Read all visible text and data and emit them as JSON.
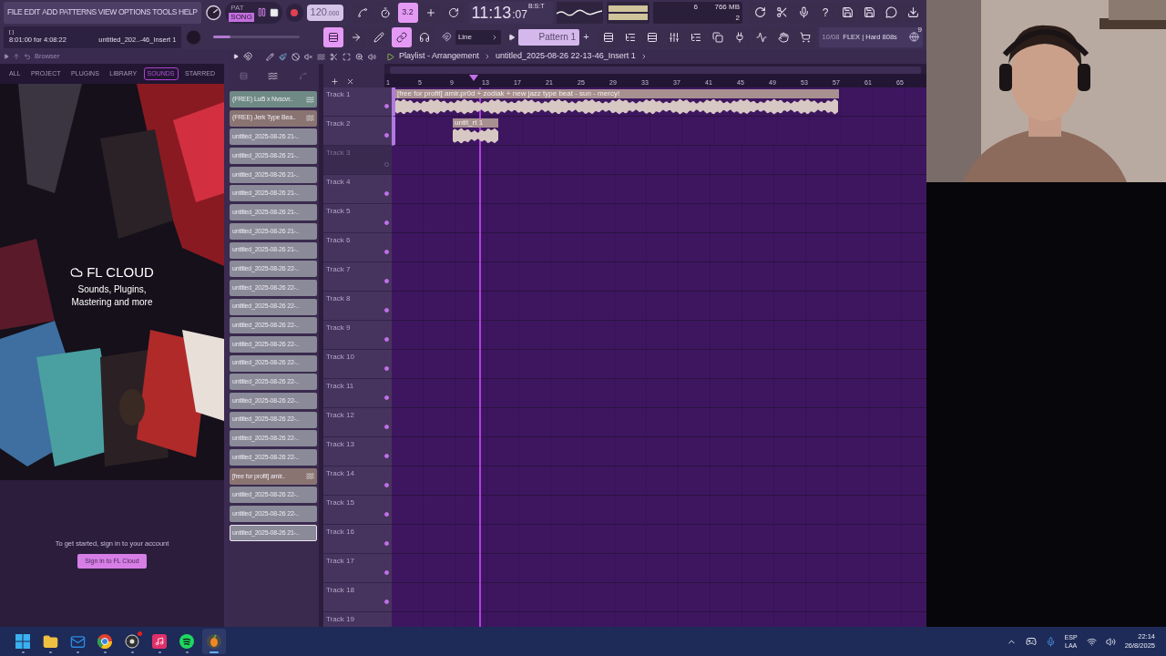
{
  "menu": [
    "FILE",
    "EDIT",
    "ADD",
    "PATTERNS",
    "VIEW",
    "OPTIONS",
    "TOOLS",
    "HELP"
  ],
  "transport": {
    "modes": [
      {
        "label": "PAT",
        "selected": false
      },
      {
        "label": "SONG",
        "selected": true
      }
    ],
    "tempo": "120",
    "tempo_fraction": ".000"
  },
  "tool_buttons": [
    {
      "on": false
    },
    {
      "on": false
    },
    {
      "label": "3.2",
      "on": true
    },
    {
      "on": false
    },
    {
      "on": false
    }
  ],
  "clock": {
    "main": "11:13",
    "seconds": ":07",
    "unit": "B:S:T"
  },
  "resources": {
    "voices": "6",
    "memory": "766 MB",
    "cores": "2"
  },
  "help_label": "?",
  "hint": {
    "bracket": "[ ]",
    "time": "8:01:00 for 4:08:22",
    "target": "untitled_202..-46_Insert 1"
  },
  "master_pitch": {
    "level": 0.2
  },
  "mode_buttons": [
    {
      "on": true
    },
    {
      "on": false
    },
    {
      "on": false
    },
    {
      "on": true
    },
    {
      "on": false
    }
  ],
  "snap": "Line",
  "pattern": "Pattern 1",
  "pattern_add": "+",
  "news": {
    "date": "10/08",
    "title": "FLEX | Hard 808s",
    "count": "9"
  },
  "browser": {
    "title": "Browser",
    "tabs": [
      {
        "label": "ALL",
        "selected": false
      },
      {
        "label": "PROJECT",
        "selected": false
      },
      {
        "label": "PLUGINS",
        "selected": false
      },
      {
        "label": "LIBRARY",
        "selected": false
      },
      {
        "label": "SOUNDS",
        "selected": true
      },
      {
        "label": "STARRED",
        "selected": false
      }
    ],
    "promo": {
      "brand": "FL CLOUD",
      "tagline": [
        "Sounds, Plugins,",
        "Mastering and more"
      ]
    },
    "sign_in_text": "To get started, sign in to your account",
    "sign_in_button": "Sign in to FL Cloud"
  },
  "playlist": {
    "title": "Playlist - Arrangement",
    "project": "untitled_2025-08-26 22-13-46_Insert 1",
    "sources": [
      {
        "label": "(FREE) Lui5 x Nvscvr..",
        "color": "#6f8a84",
        "audio": true,
        "selected": false
      },
      {
        "label": "(FREE) Jerk Type Bea..",
        "color": "#8a7472",
        "audio": true,
        "selected": false
      },
      {
        "label": "untitled_2025-08-26 21-..",
        "color": "#8a8a98",
        "audio": false,
        "selected": false
      },
      {
        "label": "untitled_2025-08-26 21-..",
        "color": "#8a8a98",
        "audio": false,
        "selected": false
      },
      {
        "label": "untitled_2025-08-26 21-..",
        "color": "#8a8a98",
        "audio": false,
        "selected": false
      },
      {
        "label": "untitled_2025-08-26 21-..",
        "color": "#8a8a98",
        "audio": false,
        "selected": false
      },
      {
        "label": "untitled_2025-08-26 21-..",
        "color": "#8a8a98",
        "audio": false,
        "selected": false
      },
      {
        "label": "untitled_2025-08-26 21-..",
        "color": "#8a8a98",
        "audio": false,
        "selected": false
      },
      {
        "label": "untitled_2025-08-26 21-..",
        "color": "#8a8a98",
        "audio": false,
        "selected": false
      },
      {
        "label": "untitled_2025-08-26 22-..",
        "color": "#8a8a98",
        "audio": false,
        "selected": false
      },
      {
        "label": "untitled_2025-08-26 22-..",
        "color": "#8a8a98",
        "audio": false,
        "selected": false
      },
      {
        "label": "untitled_2025-08-26 22-..",
        "color": "#8a8a98",
        "audio": false,
        "selected": false
      },
      {
        "label": "untitled_2025-08-26 22-..",
        "color": "#8a8a98",
        "audio": false,
        "selected": false
      },
      {
        "label": "untitled_2025-08-26 22-..",
        "color": "#8a8a98",
        "audio": false,
        "selected": false
      },
      {
        "label": "untitled_2025-08-26 22-..",
        "color": "#8a8a98",
        "audio": false,
        "selected": false
      },
      {
        "label": "untitled_2025-08-26 22-..",
        "color": "#8a8a98",
        "audio": false,
        "selected": false
      },
      {
        "label": "untitled_2025-08-26 22-..",
        "color": "#8a8a98",
        "audio": false,
        "selected": false
      },
      {
        "label": "untitled_2025-08-26 22-..",
        "color": "#8a8a98",
        "audio": false,
        "selected": false
      },
      {
        "label": "untitled_2025-08-26 22-..",
        "color": "#8a8a98",
        "audio": false,
        "selected": false
      },
      {
        "label": "untitled_2025-08-26 22-..",
        "color": "#8a8a98",
        "audio": false,
        "selected": false
      },
      {
        "label": "[free for profit] amir..",
        "color": "#8a7472",
        "audio": true,
        "selected": false
      },
      {
        "label": "untitled_2025-08-26 22-..",
        "color": "#8a8a98",
        "audio": false,
        "selected": false
      },
      {
        "label": "untitled_2025-08-26 22-..",
        "color": "#8a8a98",
        "audio": false,
        "selected": false
      },
      {
        "label": "untitled_2025-08-26 21-..",
        "color": "#8a8a98",
        "audio": false,
        "selected": true
      }
    ],
    "ruler": [
      "1",
      "5",
      "9",
      "13",
      "17",
      "21",
      "25",
      "29",
      "33",
      "37",
      "41",
      "45",
      "49",
      "53",
      "57",
      "61",
      "65"
    ],
    "playhead": {
      "level": 0.164
    },
    "tracks": [
      {
        "name": "Track 1",
        "muted": false,
        "clips": [
          {
            "label": "[free for profit] amir.pr0d + zodiak + new jazz type beat - sun - mercy!"
          }
        ]
      },
      {
        "name": "Track 2",
        "muted": false,
        "clips": [
          {
            "label": "untit_rt 1"
          }
        ]
      },
      {
        "name": "Track 3",
        "muted": true
      },
      {
        "name": "Track 4",
        "muted": false
      },
      {
        "name": "Track 5",
        "muted": false
      },
      {
        "name": "Track 6",
        "muted": false
      },
      {
        "name": "Track 7",
        "muted": false
      },
      {
        "name": "Track 8",
        "muted": false
      },
      {
        "name": "Track 9",
        "muted": false
      },
      {
        "name": "Track 10",
        "muted": false
      },
      {
        "name": "Track 11",
        "muted": false
      },
      {
        "name": "Track 12",
        "muted": false
      },
      {
        "name": "Track 13",
        "muted": false
      },
      {
        "name": "Track 14",
        "muted": false
      },
      {
        "name": "Track 15",
        "muted": false
      },
      {
        "name": "Track 16",
        "muted": false
      },
      {
        "name": "Track 17",
        "muted": false
      },
      {
        "name": "Track 18",
        "muted": false
      },
      {
        "name": "Track 19",
        "muted": false
      }
    ]
  },
  "taskbar": {
    "apps": [
      {
        "kind": "start",
        "selected": false,
        "notification": false
      },
      {
        "kind": "folder",
        "selected": false,
        "notification": false
      },
      {
        "kind": "mail",
        "selected": false,
        "notification": false
      },
      {
        "kind": "browser",
        "selected": false,
        "notification": false
      },
      {
        "kind": "recorder",
        "selected": false,
        "notification": true
      },
      {
        "kind": "video",
        "selected": false,
        "notification": false
      },
      {
        "kind": "music",
        "selected": false,
        "notification": false
      },
      {
        "kind": "daw",
        "selected": true,
        "notification": false
      }
    ],
    "language": "ESP",
    "region": "LAA",
    "time": "22:14",
    "date": "26/8/2025"
  }
}
